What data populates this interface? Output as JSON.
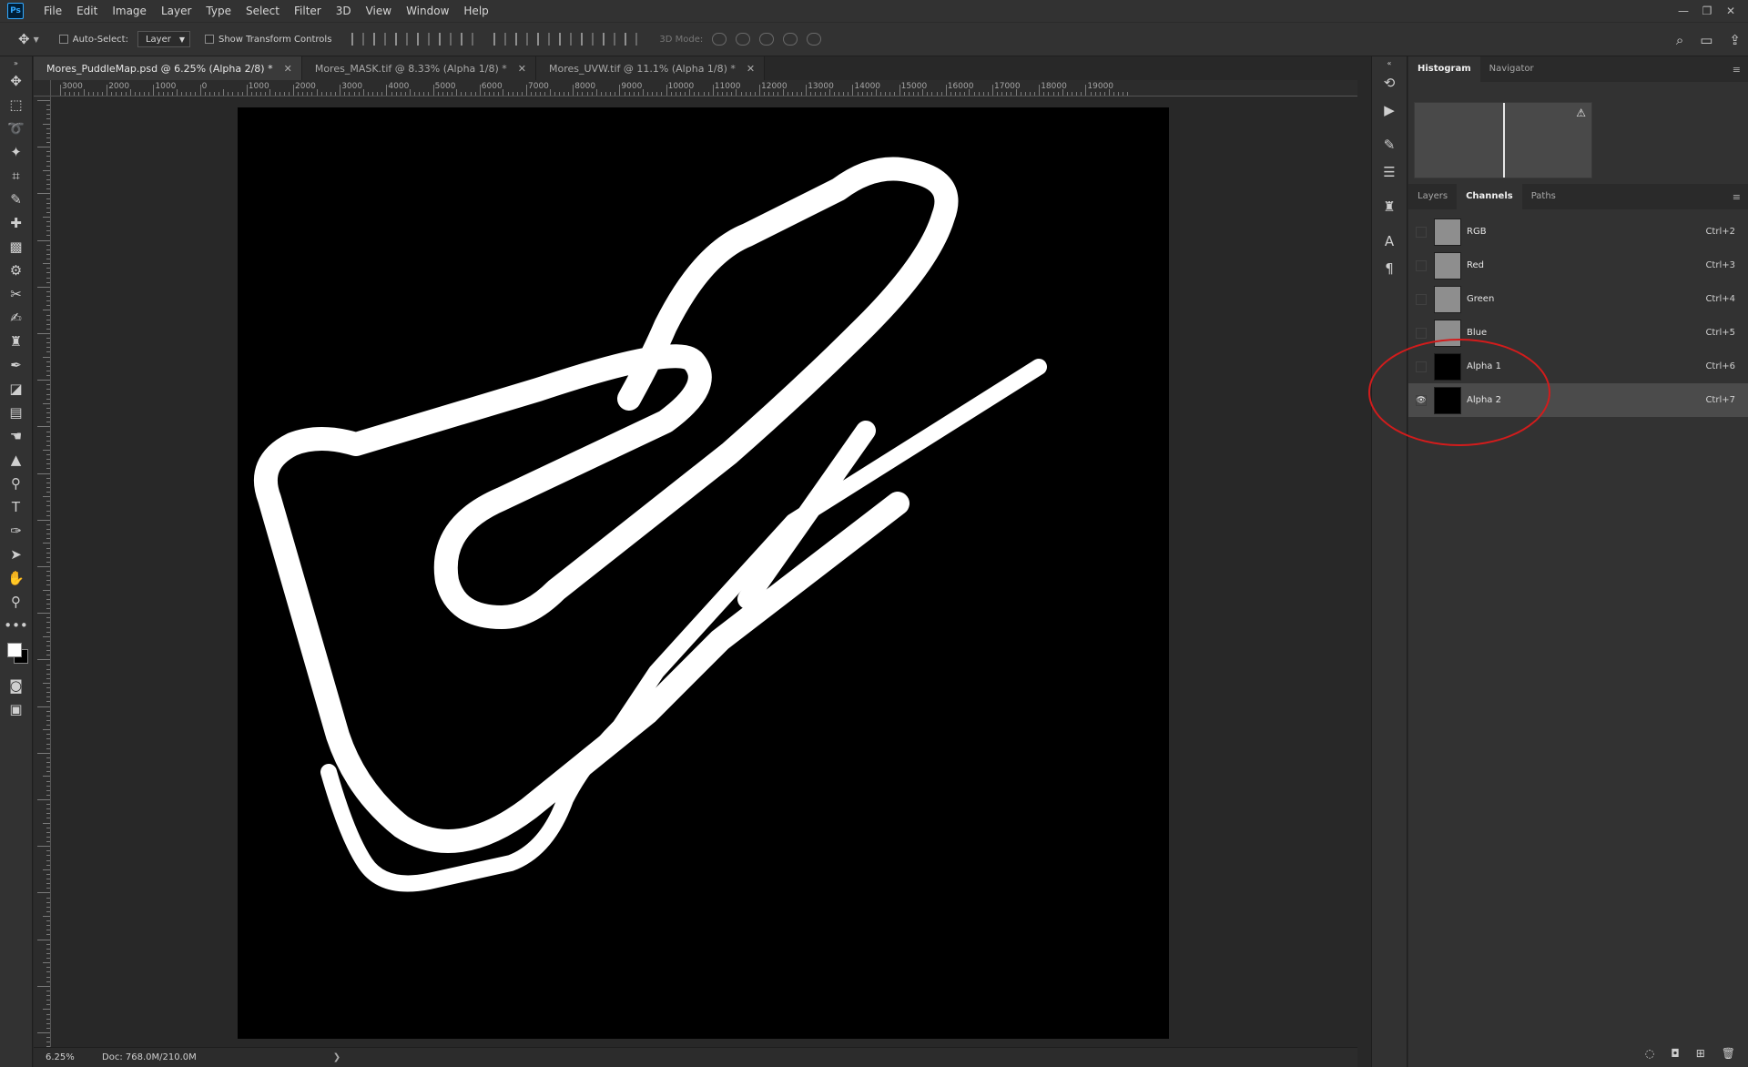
{
  "menu": [
    "File",
    "Edit",
    "Image",
    "Layer",
    "Type",
    "Select",
    "Filter",
    "3D",
    "View",
    "Window",
    "Help"
  ],
  "app_logo": "Ps",
  "window_controls": [
    "—",
    "❐",
    "✕"
  ],
  "options_bar": {
    "auto_select_label": "Auto-Select:",
    "auto_select_value": "Layer",
    "show_transform_label": "Show Transform Controls",
    "mode_label": "3D Mode:"
  },
  "tabs": [
    {
      "label": "Mores_PuddleMap.psd @ 6.25% (Alpha 2/8) *",
      "active": true
    },
    {
      "label": "Mores_MASK.tif @ 8.33% (Alpha 1/8) *",
      "active": false
    },
    {
      "label": "Mores_UVW.tif @ 11.1% (Alpha 1/8) *",
      "active": false
    }
  ],
  "ruler_labels": [
    "3000",
    "2000",
    "1000",
    "0",
    "1000",
    "2000",
    "3000",
    "4000",
    "5000",
    "6000",
    "7000",
    "8000",
    "9000",
    "10000",
    "11000",
    "12000",
    "13000",
    "14000",
    "15000",
    "16000",
    "17000",
    "18000",
    "19000"
  ],
  "status": {
    "zoom": "6.25%",
    "doc": "Doc: 768.0M/210.0M"
  },
  "panels": {
    "top_tabs": [
      "Histogram",
      "Navigator"
    ],
    "channel_tabs": [
      "Layers",
      "Channels",
      "Paths"
    ],
    "channels": [
      {
        "name": "RGB",
        "shortcut": "Ctrl+2",
        "visible": false,
        "selected": false,
        "thumb": "gray"
      },
      {
        "name": "Red",
        "shortcut": "Ctrl+3",
        "visible": false,
        "selected": false,
        "thumb": "gray"
      },
      {
        "name": "Green",
        "shortcut": "Ctrl+4",
        "visible": false,
        "selected": false,
        "thumb": "gray"
      },
      {
        "name": "Blue",
        "shortcut": "Ctrl+5",
        "visible": false,
        "selected": false,
        "thumb": "gray"
      },
      {
        "name": "Alpha 1",
        "shortcut": "Ctrl+6",
        "visible": false,
        "selected": false,
        "thumb": "dark"
      },
      {
        "name": "Alpha 2",
        "shortcut": "Ctrl+7",
        "visible": true,
        "selected": true,
        "thumb": "dark"
      }
    ]
  },
  "colors": {
    "foreground": "#ffffff",
    "background": "#000000",
    "annotation": "#d21c1c"
  }
}
